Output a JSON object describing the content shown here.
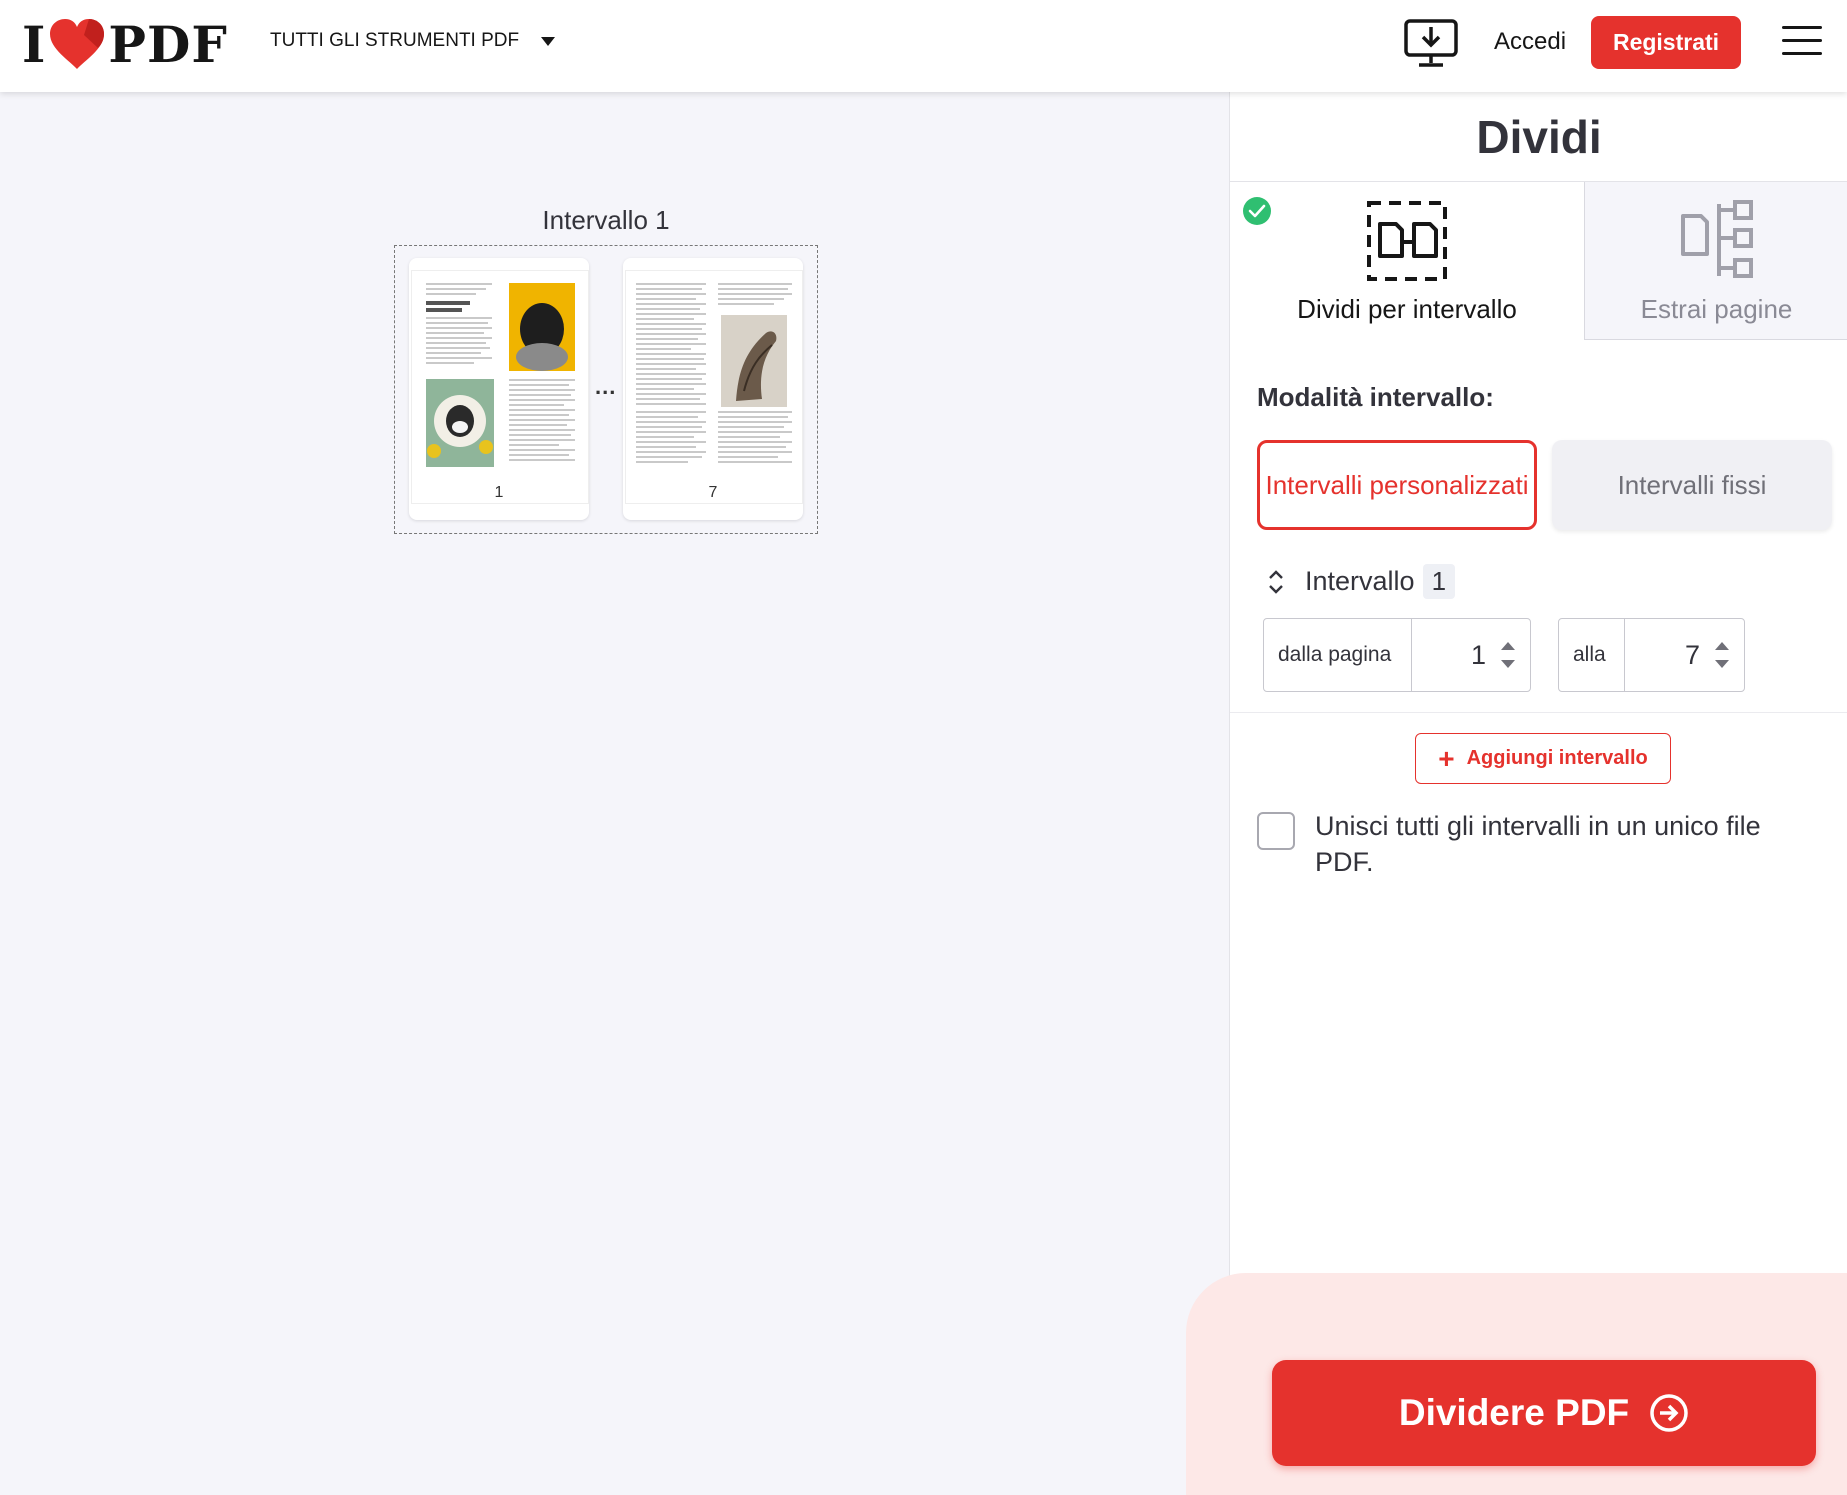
{
  "header": {
    "logo_text_left": "I",
    "logo_text_right": "PDF",
    "tools_menu_label": "TUTTI GLI STRUMENTI PDF",
    "login_label": "Accedi",
    "signup_label": "Registrati",
    "icons": [
      "heart-logo-icon",
      "chevron-down-icon",
      "desktop-download-icon",
      "hamburger-menu-icon"
    ]
  },
  "preview": {
    "range_label": "Intervallo 1",
    "first_page_number": "1",
    "last_page_number": "7",
    "ellipsis": "..."
  },
  "sidebar": {
    "title": "Dividi",
    "tabs": [
      {
        "label": "Dividi per intervallo",
        "active": true,
        "icon": "split-range-icon"
      },
      {
        "label": "Estrai pagine",
        "active": false,
        "icon": "extract-pages-icon"
      }
    ],
    "range_mode_label": "Modalità intervallo:",
    "range_modes": [
      {
        "label": "Intervalli personalizzati",
        "selected": true
      },
      {
        "label": "Intervalli fissi",
        "selected": false
      }
    ],
    "range": {
      "name": "Intervallo",
      "index": "1",
      "from_label": "dalla pagina",
      "from_value": "1",
      "to_label": "alla",
      "to_value": "7"
    },
    "add_range_label": "Aggiungi intervallo",
    "merge_label": "Unisci tutti gli intervalli in un unico file PDF.",
    "merge_checked": false
  },
  "action": {
    "split_button_label": "Dividere PDF"
  },
  "colors": {
    "brand_red": "#e5322d",
    "success_green": "#2fbf71",
    "background": "#f5f5fa",
    "footer_tint": "#fde8e7"
  }
}
